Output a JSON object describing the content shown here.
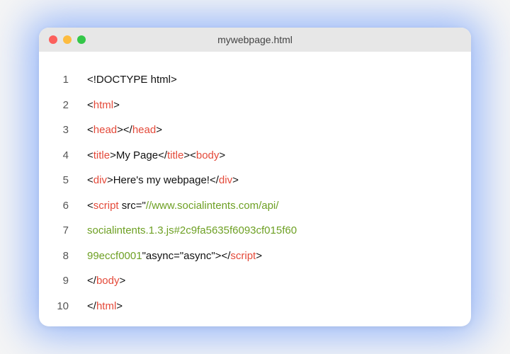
{
  "window": {
    "title": "mywebpage.html"
  },
  "code": {
    "lines": [
      {
        "num": "1",
        "segments": [
          {
            "cls": "txt",
            "t": "<!DOCTYPE html>"
          }
        ]
      },
      {
        "num": "2",
        "segments": [
          {
            "cls": "txt",
            "t": "<"
          },
          {
            "cls": "tag",
            "t": "html"
          },
          {
            "cls": "txt",
            "t": ">"
          }
        ]
      },
      {
        "num": "3",
        "segments": [
          {
            "cls": "txt",
            "t": "<"
          },
          {
            "cls": "tag",
            "t": "head"
          },
          {
            "cls": "txt",
            "t": "></"
          },
          {
            "cls": "tag",
            "t": "head"
          },
          {
            "cls": "txt",
            "t": ">"
          }
        ]
      },
      {
        "num": "4",
        "segments": [
          {
            "cls": "txt",
            "t": "<"
          },
          {
            "cls": "tag",
            "t": "title"
          },
          {
            "cls": "txt",
            "t": ">My Page</"
          },
          {
            "cls": "tag",
            "t": "title"
          },
          {
            "cls": "txt",
            "t": "><"
          },
          {
            "cls": "tag",
            "t": "body"
          },
          {
            "cls": "txt",
            "t": ">"
          }
        ]
      },
      {
        "num": "5",
        "segments": [
          {
            "cls": "txt",
            "t": "<"
          },
          {
            "cls": "tag",
            "t": "div"
          },
          {
            "cls": "txt",
            "t": ">Here's my webpage!</"
          },
          {
            "cls": "tag",
            "t": "div"
          },
          {
            "cls": "txt",
            "t": ">"
          }
        ]
      },
      {
        "num": "6",
        "segments": [
          {
            "cls": "txt",
            "t": "<"
          },
          {
            "cls": "tag",
            "t": "script"
          },
          {
            "cls": "txt",
            "t": " src=\""
          },
          {
            "cls": "str",
            "t": "//www.socialintents.com/api/"
          }
        ]
      },
      {
        "num": "7",
        "segments": [
          {
            "cls": "str",
            "t": "socialintents.1.3.js#2c9fa5635f6093cf015f60"
          }
        ]
      },
      {
        "num": "8",
        "segments": [
          {
            "cls": "str",
            "t": "99eccf0001"
          },
          {
            "cls": "txt",
            "t": "\"async=\"async\"></"
          },
          {
            "cls": "tag",
            "t": "script"
          },
          {
            "cls": "txt",
            "t": ">"
          }
        ]
      },
      {
        "num": "9",
        "segments": [
          {
            "cls": "txt",
            "t": "</"
          },
          {
            "cls": "tag",
            "t": "body"
          },
          {
            "cls": "txt",
            "t": ">"
          }
        ]
      },
      {
        "num": "10",
        "segments": [
          {
            "cls": "txt",
            "t": " </"
          },
          {
            "cls": "tag",
            "t": "html"
          },
          {
            "cls": "txt",
            "t": ">"
          }
        ]
      }
    ]
  }
}
